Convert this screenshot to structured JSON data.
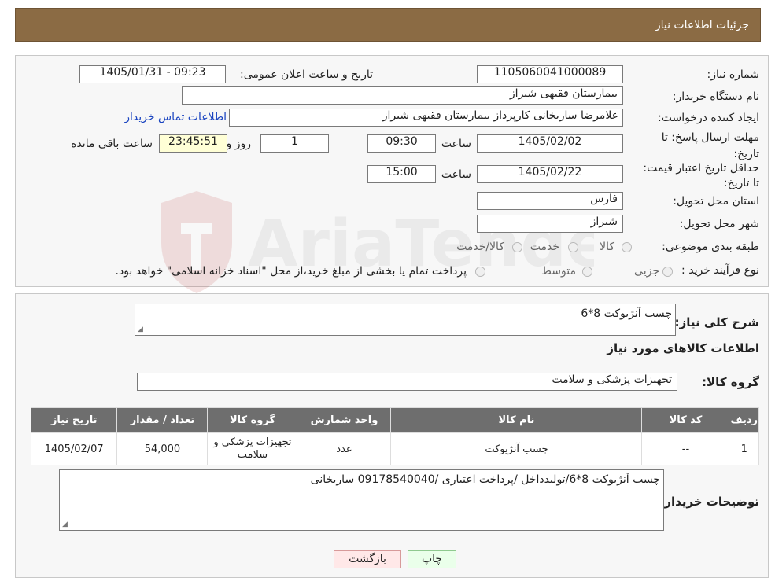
{
  "header": {
    "title": "جزئیات اطلاعات نیاز"
  },
  "form": {
    "need_number_label": "شماره نیاز:",
    "need_number": "1105060041000089",
    "announce_label": "تاریخ و ساعت اعلان عمومی:",
    "announce_value": "1405/01/31 - 09:23",
    "buyer_org_label": "نام دستگاه خریدار:",
    "buyer_org": "بیمارستان فقیهی شیراز",
    "creator_label": "ایجاد کننده درخواست:",
    "creator": "غلامرضا ساریخانی کارپرداز بیمارستان فقیهی شیراز",
    "contact_link": "اطلاعات تماس خریدار",
    "reply_deadline_label": "مهلت ارسال پاسخ: تا تاریخ:",
    "reply_date": "1405/02/02",
    "time_label": "ساعت",
    "reply_time": "09:30",
    "days": "1",
    "days_label": "روز و",
    "remaining_time": "23:45:51",
    "remaining_label": "ساعت باقی مانده",
    "price_validity_label": "حداقل تاریخ اعتبار قیمت: تا تاریخ:",
    "validity_date": "1405/02/22",
    "validity_time": "15:00",
    "province_label": "استان محل تحویل:",
    "province": "فارس",
    "city_label": "شهر محل تحویل:",
    "city": "شیراز",
    "category_label": "طبقه بندی موضوعی:",
    "category_options": [
      "کالا",
      "خدمت",
      "کالا/خدمت"
    ],
    "process_label": "نوع فرآیند خرید :",
    "process_options": [
      "جزیی",
      "متوسط"
    ],
    "process_note": "پرداخت تمام یا بخشی از مبلغ خرید،از محل \"اسناد خزانه اسلامی\" خواهد بود."
  },
  "details": {
    "summary_label": "شرح کلی نیاز:",
    "summary": "چسب آنژیوکت 8*6",
    "items_heading": "اطلاعات کالاهای مورد نیاز",
    "group_label": "گروه کالا:",
    "group": "تجهیزات پزشکی و سلامت",
    "table": {
      "headers": [
        "ردیف",
        "کد کالا",
        "نام کالا",
        "واحد شمارش",
        "گروه کالا",
        "تعداد / مقدار",
        "تاریخ نیاز"
      ],
      "rows": [
        [
          "1",
          "--",
          "چسب آنژیوکت",
          "عدد",
          "تجهیزات پزشکی و سلامت",
          "54,000",
          "1405/02/07"
        ]
      ]
    },
    "buyer_notes_label": "توضیحات خریدار:",
    "buyer_notes": "چسب آنژیوکت 8*6/تولیدداخل /پرداخت اعتباری /09178540040 ساریخانی"
  },
  "buttons": {
    "print": "چاپ",
    "back": "بازگشت"
  },
  "watermark": {
    "text": "AriaTender.neT"
  },
  "colors": {
    "header_bg": "#8b6b44",
    "table_header_bg": "#6e6e6e",
    "link": "#1a44c0"
  }
}
